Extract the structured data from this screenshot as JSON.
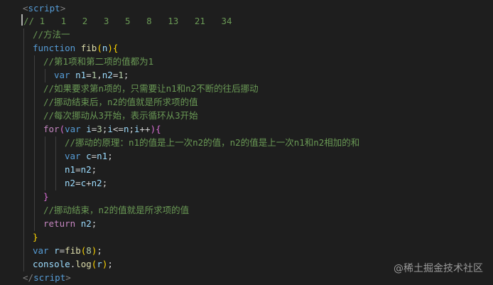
{
  "editor": {
    "open_tag": {
      "lt": "<",
      "name": "script",
      "gt": ">"
    },
    "close_tag": {
      "lt": "</",
      "name": "script",
      "gt": ">"
    },
    "line_fib_sequence": "// 1   1   2   3   5   8   13   21   34",
    "comment_method": "//方法一",
    "kw_function": "function",
    "fn_name": "fib",
    "param_n": "n",
    "comment_first_two": "//第1项和第二项的值都为1",
    "kw_var": "var",
    "var_n1": "n1",
    "var_n2": "n2",
    "var_c": "c",
    "var_i": "i",
    "var_r": "r",
    "num_1": "1",
    "num_3": "3",
    "num_8": "8",
    "comment_if_nth": "//如果要求第n项的，只需要让n1和n2不断的往后挪动",
    "comment_after_move": "//挪动结束后，n2的值就是所求项的值",
    "comment_each_move": "//每次挪动从3开始，表示循环从3开始",
    "kw_for": "for",
    "comment_principle": "//挪动的原理：n1的值是上一次n2的值，n2的值是上一次n1和n2相加的和",
    "comment_end": "//挪动结束，n2的值就是所求项的值",
    "kw_return": "return",
    "console": "console",
    "log": "log"
  },
  "watermark": "@稀土掘金技术社区",
  "colors": {
    "background": "#1e1e1e",
    "keyword": "#569cd6",
    "control": "#c586c0",
    "function": "#dcdcaa",
    "variable": "#9cdcfe",
    "number": "#b5cea8",
    "comment": "#6a9955",
    "bracket_level1": "#ffd700",
    "bracket_level2": "#da70d6",
    "bracket_level3": "#179fff"
  }
}
